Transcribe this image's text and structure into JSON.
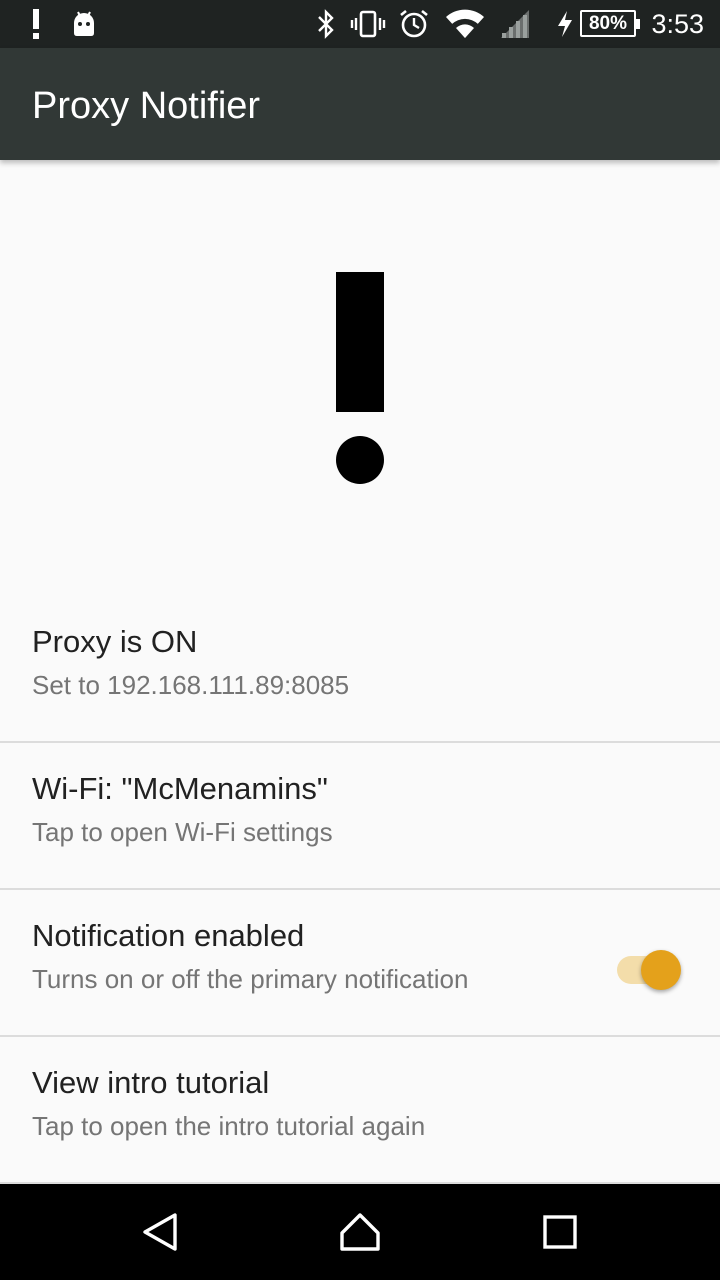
{
  "status_bar": {
    "time": "3:53",
    "battery_percent": "80%",
    "icons": [
      "alert-icon",
      "android-icon",
      "bluetooth-icon",
      "vibrate-icon",
      "alarm-icon",
      "wifi-icon",
      "signal-icon",
      "charging-icon"
    ]
  },
  "app_bar": {
    "title": "Proxy Notifier"
  },
  "hero": {
    "icon": "exclamation-icon"
  },
  "preferences": [
    {
      "title": "Proxy is ON",
      "summary": "Set to 192.168.111.89:8085"
    },
    {
      "title": "Wi-Fi: \"McMenamins\"",
      "summary": "Tap to open Wi-Fi settings"
    },
    {
      "title": "Notification enabled",
      "summary": "Turns on or off the primary notification",
      "switch_on": true
    },
    {
      "title": "View intro tutorial",
      "summary": "Tap to open the intro tutorial again"
    }
  ],
  "colors": {
    "app_bar": "#313836",
    "status_bar": "#1f2322",
    "accent": "#e4a11b",
    "switch_track": "#f3ddaa"
  },
  "nav_bar": {
    "buttons": [
      "back-icon",
      "home-icon",
      "recents-icon"
    ]
  }
}
